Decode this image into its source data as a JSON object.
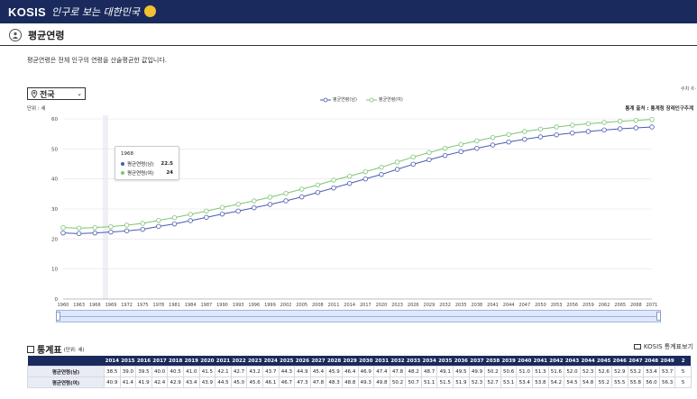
{
  "header": {
    "brand": "KOSIS",
    "slogan": "인구로 보는 대한민국"
  },
  "page": {
    "title": "평균연령",
    "description": "평균연령은 전체 인구의 연령을 산술평균한 값입니다."
  },
  "controls": {
    "region": "전국",
    "unit_label": "단위 : 세",
    "right_label": "수치 ©·",
    "source": "통계 출처 : 통계청 장래인구추계"
  },
  "tooltip": {
    "year": "1968",
    "male_label": "평균연령(남)",
    "male_value": "22.5",
    "female_label": "평균연령(여)",
    "female_value": "24"
  },
  "table_section": {
    "title": "통계표",
    "unit": "(단위: 세)",
    "link": "KOSIS 통계표보기"
  },
  "table": {
    "years": [
      "2014",
      "2015",
      "2016",
      "2017",
      "2018",
      "2019",
      "2020",
      "2021",
      "2022",
      "2023",
      "2024",
      "2025",
      "2026",
      "2027",
      "2028",
      "2029",
      "2030",
      "2031",
      "2032",
      "2033",
      "2034",
      "2035",
      "2036",
      "2037",
      "2038",
      "2039",
      "2040",
      "2041",
      "2042",
      "2043",
      "2044",
      "2045",
      "2046",
      "2047",
      "2048",
      "2049",
      "2"
    ],
    "rows": [
      {
        "label": "평균연령(남)",
        "values": [
          "38.5",
          "39.0",
          "39.5",
          "40.0",
          "40.5",
          "41.0",
          "41.5",
          "42.1",
          "42.7",
          "43.2",
          "43.7",
          "44.3",
          "44.9",
          "45.4",
          "45.9",
          "46.4",
          "46.9",
          "47.4",
          "47.8",
          "48.2",
          "48.7",
          "49.1",
          "49.5",
          "49.9",
          "50.2",
          "50.6",
          "51.0",
          "51.3",
          "51.6",
          "52.0",
          "52.3",
          "52.6",
          "52.9",
          "53.2",
          "53.4",
          "53.7",
          "5"
        ]
      },
      {
        "label": "평균연령(여)",
        "values": [
          "40.9",
          "41.4",
          "41.9",
          "42.4",
          "42.9",
          "43.4",
          "43.9",
          "44.5",
          "45.0",
          "45.6",
          "46.1",
          "46.7",
          "47.3",
          "47.8",
          "48.3",
          "48.8",
          "49.3",
          "49.8",
          "50.2",
          "50.7",
          "51.1",
          "51.5",
          "51.9",
          "52.3",
          "52.7",
          "53.1",
          "53.4",
          "53.8",
          "54.2",
          "54.5",
          "54.8",
          "55.2",
          "55.5",
          "55.8",
          "56.0",
          "56.3",
          "5"
        ]
      }
    ]
  },
  "chart_data": {
    "type": "line",
    "xlabel": "",
    "ylabel": "",
    "ylim": [
      0,
      60
    ],
    "yticks": [
      0,
      10,
      20,
      30,
      40,
      50,
      60
    ],
    "xtick_labels": [
      "1960",
      "1963",
      "1966",
      "1969",
      "1972",
      "1975",
      "1978",
      "1981",
      "1984",
      "1987",
      "1990",
      "1993",
      "1996",
      "1999",
      "2002",
      "2005",
      "2008",
      "2011",
      "2014",
      "2017",
      "2020",
      "2023",
      "2026",
      "2029",
      "2032",
      "2035",
      "2038",
      "2041",
      "2044",
      "2047",
      "2050",
      "2053",
      "2056",
      "2059",
      "2062",
      "2065",
      "2068",
      "2071"
    ],
    "x": [
      1960,
      1963,
      1966,
      1969,
      1972,
      1975,
      1978,
      1981,
      1984,
      1987,
      1990,
      1993,
      1996,
      1999,
      2002,
      2005,
      2008,
      2011,
      2014,
      2017,
      2020,
      2023,
      2026,
      2029,
      2032,
      2035,
      2038,
      2041,
      2044,
      2047,
      2050,
      2053,
      2056,
      2059,
      2062,
      2065,
      2068,
      2071
    ],
    "series": [
      {
        "name": "평균연령(남)",
        "color": "#4a5bb0",
        "values": [
          22.0,
          21.8,
          22.0,
          22.3,
          22.7,
          23.2,
          24.2,
          25.0,
          26.1,
          27.2,
          28.3,
          29.3,
          30.4,
          31.5,
          32.7,
          34.0,
          35.5,
          37.0,
          38.5,
          40.0,
          41.5,
          43.2,
          44.9,
          46.4,
          47.8,
          49.1,
          50.2,
          51.3,
          52.3,
          53.2,
          54.0,
          54.7,
          55.3,
          55.8,
          56.3,
          56.7,
          57.0,
          57.3
        ]
      },
      {
        "name": "평균연령(여)",
        "color": "#7cc576",
        "values": [
          23.8,
          23.6,
          23.8,
          24.1,
          24.6,
          25.2,
          26.2,
          27.1,
          28.2,
          29.3,
          30.5,
          31.6,
          32.7,
          33.9,
          35.2,
          36.6,
          38.0,
          39.6,
          40.9,
          42.4,
          43.9,
          45.6,
          47.3,
          48.8,
          50.2,
          51.5,
          52.7,
          53.8,
          54.8,
          55.8,
          56.6,
          57.3,
          57.9,
          58.4,
          58.8,
          59.2,
          59.5,
          59.8
        ]
      }
    ],
    "highlight_x": 1968,
    "legend_position": "top-center",
    "grid": "horizontal"
  }
}
